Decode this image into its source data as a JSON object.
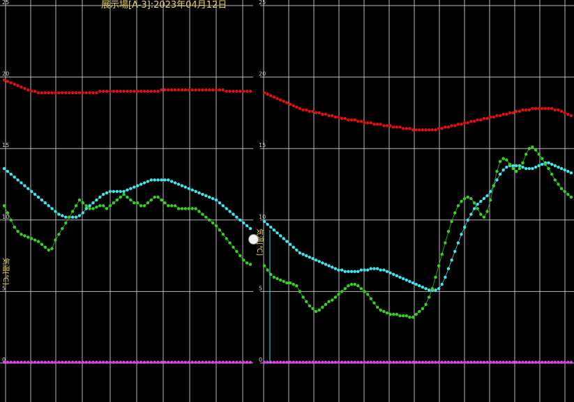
{
  "title": "展示場[A-3]:2023年04月12日",
  "ylabel": "気温[℃]",
  "colors": {
    "background": "#000000",
    "grid": "#d8d8d8",
    "axis_text": "#cfcfcf",
    "title_text": "#e6d65a",
    "handle": "#f2f2f2"
  },
  "chart_data": [
    {
      "type": "line",
      "title": "展示場[A-3]:2023年04月12日",
      "ylabel": "気温[℃]",
      "xlabel": "",
      "ylim": [
        0,
        25
      ],
      "yticks": [
        "0",
        "5",
        "10",
        "15",
        "20",
        "25"
      ],
      "grid": true,
      "x": [
        0,
        1,
        2,
        3,
        4,
        5,
        6,
        7,
        8,
        9,
        10,
        11,
        12,
        13,
        14,
        15,
        16,
        17,
        18,
        19,
        20,
        21,
        22,
        23,
        24,
        25,
        26,
        27,
        28,
        29,
        30,
        31,
        32,
        33,
        34,
        35,
        36,
        37,
        38,
        39,
        40,
        41,
        42,
        43,
        44,
        45,
        46,
        47,
        48,
        49,
        50,
        51,
        52,
        53,
        54,
        55,
        56,
        57,
        58,
        59,
        60,
        61,
        62,
        63,
        64,
        65,
        66,
        67,
        68,
        69,
        70,
        71,
        72
      ],
      "series": [
        {
          "color": "#e01010",
          "values": [
            19.8,
            19.7,
            19.6,
            19.5,
            19.4,
            19.3,
            19.2,
            19.1,
            19.0,
            19.0,
            18.9,
            18.9,
            18.9,
            18.9,
            18.9,
            18.9,
            18.9,
            18.9,
            18.9,
            18.9,
            18.9,
            18.9,
            18.9,
            18.9,
            18.9,
            18.9,
            18.9,
            18.9,
            19.0,
            19.0,
            19.0,
            19.0,
            19.0,
            19.0,
            19.0,
            19.0,
            19.0,
            19.0,
            19.0,
            19.0,
            19.0,
            19.0,
            19.0,
            19.0,
            19.0,
            19.0,
            19.1,
            19.1,
            19.1,
            19.1,
            19.1,
            19.1,
            19.1,
            19.1,
            19.1,
            19.1,
            19.1,
            19.1,
            19.1,
            19.1,
            19.1,
            19.1,
            19.1,
            19.1,
            19.1,
            19.0,
            19.0,
            19.0,
            19.0,
            19.0,
            19.0,
            19.0,
            19.0
          ]
        },
        {
          "color": "#3ee6ee",
          "values": [
            13.6,
            13.4,
            13.2,
            13.0,
            12.8,
            12.6,
            12.4,
            12.2,
            12.0,
            11.8,
            11.6,
            11.4,
            11.2,
            11.0,
            10.8,
            10.6,
            10.4,
            10.3,
            10.2,
            10.2,
            10.2,
            10.2,
            10.3,
            10.5,
            10.8,
            11.0,
            11.2,
            11.4,
            11.6,
            11.8,
            11.9,
            12.0,
            12.0,
            12.0,
            12.0,
            12.0,
            12.1,
            12.2,
            12.3,
            12.4,
            12.5,
            12.6,
            12.7,
            12.8,
            12.8,
            12.8,
            12.8,
            12.8,
            12.8,
            12.7,
            12.6,
            12.5,
            12.4,
            12.3,
            12.2,
            12.1,
            12.0,
            11.9,
            11.8,
            11.7,
            11.6,
            11.5,
            11.4,
            11.2,
            11.0,
            10.8,
            10.6,
            10.4,
            10.2,
            10.0,
            9.8,
            9.6,
            9.4
          ]
        },
        {
          "color": "#35d31f",
          "values": [
            11.0,
            10.5,
            10.0,
            9.5,
            9.2,
            9.0,
            8.9,
            8.8,
            8.7,
            8.6,
            8.5,
            8.3,
            8.1,
            7.9,
            8.0,
            8.6,
            9.0,
            9.4,
            9.8,
            10.2,
            10.6,
            11.0,
            11.4,
            11.2,
            11.0,
            10.8,
            10.8,
            10.9,
            11.0,
            11.0,
            10.8,
            11.0,
            11.2,
            11.4,
            11.6,
            11.8,
            11.6,
            11.4,
            11.2,
            11.2,
            11.0,
            11.0,
            11.2,
            11.4,
            11.6,
            11.6,
            11.4,
            11.2,
            11.0,
            11.0,
            11.0,
            10.8,
            10.8,
            10.8,
            10.8,
            10.8,
            10.8,
            10.6,
            10.4,
            10.2,
            10.0,
            9.8,
            9.6,
            9.3,
            9.0,
            8.7,
            8.4,
            8.1,
            7.8,
            7.5,
            7.2,
            7.0,
            6.9
          ]
        },
        {
          "color": "#e040e8",
          "values": [
            0.05,
            0.05,
            0.05,
            0.05,
            0.05,
            0.05,
            0.05,
            0.05,
            0.05,
            0.05,
            0.05,
            0.05,
            0.05,
            0.05,
            0.05,
            0.05,
            0.05,
            0.05,
            0.05,
            0.05,
            0.05,
            0.05,
            0.05,
            0.05,
            0.05,
            0.05,
            0.05,
            0.05,
            0.05,
            0.05,
            0.05,
            0.05,
            0.05,
            0.05,
            0.05,
            0.05,
            0.05,
            0.05,
            0.05,
            0.05,
            0.05,
            0.05,
            0.05,
            0.05,
            0.05,
            0.05,
            0.05,
            0.05,
            0.05,
            0.05,
            0.05,
            0.05,
            0.05,
            0.05,
            0.05,
            0.05,
            0.05,
            0.05,
            0.05,
            0.05,
            0.05,
            0.05,
            0.05,
            0.05,
            0.05,
            0.05,
            0.05,
            0.05,
            0.05,
            0.05,
            0.05,
            0.05,
            0.05
          ]
        }
      ]
    },
    {
      "type": "line",
      "title": "",
      "ylabel": "気温[℃]",
      "xlabel": "",
      "ylim": [
        0,
        25
      ],
      "yticks": [
        "0",
        "5",
        "10",
        "15",
        "20",
        "25"
      ],
      "grid": true,
      "x": [
        0,
        1,
        2,
        3,
        4,
        5,
        6,
        7,
        8,
        9,
        10,
        11,
        12,
        13,
        14,
        15,
        16,
        17,
        18,
        19,
        20,
        21,
        22,
        23,
        24,
        25,
        26,
        27,
        28,
        29,
        30,
        31,
        32,
        33,
        34,
        35,
        36,
        37,
        38,
        39,
        40,
        41,
        42,
        43,
        44,
        45,
        46,
        47,
        48,
        49,
        50,
        51,
        52,
        53,
        54,
        55,
        56,
        57,
        58,
        59,
        60,
        61,
        62,
        63,
        64,
        65,
        66,
        67,
        68,
        69,
        70,
        71,
        72,
        73,
        74,
        75,
        76,
        77,
        78,
        79,
        80,
        81,
        82,
        83,
        84,
        85,
        86,
        87,
        88,
        89,
        90,
        91,
        92,
        93,
        94,
        95
      ],
      "series": [
        {
          "color": "#e01010",
          "values": [
            18.9,
            18.8,
            18.7,
            18.6,
            18.5,
            18.4,
            18.3,
            18.2,
            18.1,
            18.0,
            17.9,
            17.8,
            17.7,
            17.7,
            17.6,
            17.6,
            17.5,
            17.5,
            17.4,
            17.4,
            17.3,
            17.3,
            17.2,
            17.2,
            17.1,
            17.1,
            17.0,
            17.0,
            17.0,
            16.9,
            16.9,
            16.8,
            16.8,
            16.8,
            16.7,
            16.7,
            16.7,
            16.6,
            16.6,
            16.6,
            16.5,
            16.5,
            16.5,
            16.4,
            16.4,
            16.4,
            16.3,
            16.3,
            16.3,
            16.3,
            16.3,
            16.3,
            16.3,
            16.3,
            16.4,
            16.4,
            16.5,
            16.5,
            16.6,
            16.6,
            16.7,
            16.7,
            16.8,
            16.8,
            16.9,
            16.9,
            17.0,
            17.0,
            17.1,
            17.1,
            17.2,
            17.2,
            17.3,
            17.3,
            17.4,
            17.4,
            17.5,
            17.5,
            17.6,
            17.6,
            17.7,
            17.7,
            17.7,
            17.8,
            17.8,
            17.8,
            17.8,
            17.8,
            17.8,
            17.8,
            17.7,
            17.7,
            17.6,
            17.5,
            17.4,
            17.3
          ]
        },
        {
          "color": "#3ee6ee",
          "values": [
            9.9,
            9.7,
            9.5,
            9.3,
            9.1,
            8.9,
            8.7,
            8.5,
            8.3,
            8.1,
            7.9,
            7.7,
            7.6,
            7.5,
            7.4,
            7.3,
            7.2,
            7.1,
            7.0,
            6.9,
            6.8,
            6.7,
            6.6,
            6.5,
            6.5,
            6.4,
            6.4,
            6.4,
            6.4,
            6.4,
            6.5,
            6.5,
            6.5,
            6.6,
            6.6,
            6.6,
            6.5,
            6.5,
            6.4,
            6.3,
            6.2,
            6.1,
            6.0,
            5.9,
            5.8,
            5.7,
            5.6,
            5.5,
            5.4,
            5.3,
            5.2,
            5.1,
            5.1,
            5.1,
            5.2,
            5.5,
            6.0,
            6.6,
            7.2,
            7.8,
            8.4,
            9.0,
            9.5,
            10.0,
            10.4,
            10.8,
            11.1,
            11.3,
            11.5,
            11.7,
            12.0,
            12.4,
            12.8,
            13.2,
            13.5,
            13.7,
            13.8,
            13.8,
            13.8,
            13.8,
            13.7,
            13.6,
            13.6,
            13.6,
            13.7,
            13.8,
            13.9,
            14.0,
            14.0,
            13.9,
            13.8,
            13.7,
            13.6,
            13.5,
            13.4,
            13.3
          ]
        },
        {
          "color": "#35d31f",
          "values": [
            6.8,
            6.5,
            6.2,
            6.0,
            5.9,
            5.8,
            5.7,
            5.6,
            5.6,
            5.5,
            5.4,
            5.0,
            4.6,
            4.3,
            4.0,
            3.8,
            3.6,
            3.7,
            3.9,
            4.1,
            4.3,
            4.4,
            4.6,
            4.8,
            5.0,
            5.2,
            5.4,
            5.5,
            5.5,
            5.4,
            5.2,
            5.0,
            4.8,
            4.5,
            4.2,
            3.9,
            3.7,
            3.6,
            3.5,
            3.4,
            3.4,
            3.4,
            3.3,
            3.3,
            3.3,
            3.2,
            3.2,
            3.4,
            3.6,
            3.8,
            4.1,
            4.6,
            5.2,
            6.0,
            6.8,
            7.6,
            8.4,
            9.2,
            9.9,
            10.5,
            11.0,
            11.3,
            11.5,
            11.6,
            11.5,
            11.2,
            10.8,
            10.4,
            10.2,
            10.6,
            11.4,
            12.4,
            13.4,
            14.1,
            14.3,
            14.2,
            13.9,
            13.6,
            13.4,
            13.6,
            14.0,
            14.6,
            15.0,
            15.1,
            14.9,
            14.6,
            14.3,
            13.9,
            13.6,
            13.2,
            12.8,
            12.5,
            12.2,
            12.0,
            11.8,
            11.6
          ]
        },
        {
          "color": "#e040e8",
          "values": [
            0.05,
            0.05,
            0.05,
            0.05,
            0.05,
            0.05,
            0.05,
            0.05,
            0.05,
            0.05,
            0.05,
            0.05,
            0.05,
            0.05,
            0.05,
            0.05,
            0.05,
            0.05,
            0.05,
            0.05,
            0.05,
            0.05,
            0.05,
            0.05,
            0.05,
            0.05,
            0.05,
            0.05,
            0.05,
            0.05,
            0.05,
            0.05,
            0.05,
            0.05,
            0.05,
            0.05,
            0.05,
            0.05,
            0.05,
            0.05,
            0.05,
            0.05,
            0.05,
            0.05,
            0.05,
            0.05,
            0.05,
            0.05,
            0.05,
            0.05,
            0.05,
            0.05,
            0.05,
            0.05,
            0.05,
            0.05,
            0.05,
            0.05,
            0.05,
            0.05,
            0.05,
            0.05,
            0.05,
            0.05,
            0.05,
            0.05,
            0.05,
            0.05,
            0.05,
            0.05,
            0.05,
            0.05,
            0.05,
            0.05,
            0.05,
            0.05,
            0.05,
            0.05,
            0.05,
            0.05,
            0.05,
            0.05,
            0.05,
            0.05,
            0.05,
            0.05,
            0.05,
            0.05,
            0.05,
            0.05,
            0.05,
            0.05,
            0.05,
            0.05,
            0.05,
            0.05
          ]
        }
      ]
    }
  ]
}
